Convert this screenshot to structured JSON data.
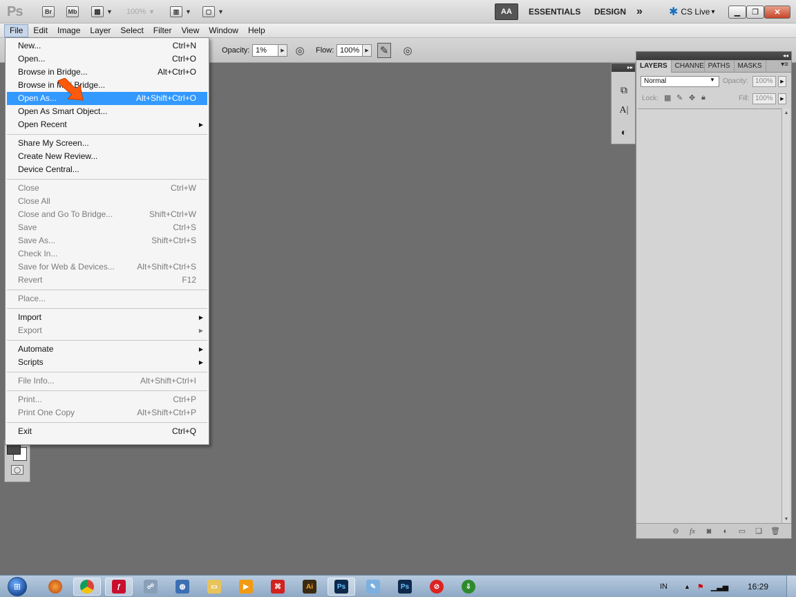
{
  "titlebar": {
    "app_logo": "Ps",
    "bridge": "Br",
    "mini_bridge": "Mb",
    "zoom": "100%",
    "workspace_current": "AA",
    "workspace_essentials": "ESSENTIALS",
    "workspace_design": "DESIGN",
    "more": "»",
    "cs_live": "CS Live",
    "cs_live_arrow": "▾"
  },
  "menubar": {
    "items": [
      "File",
      "Edit",
      "Image",
      "Layer",
      "Select",
      "Filter",
      "View",
      "Window",
      "Help"
    ]
  },
  "options": {
    "opacity_label": "Opacity:",
    "opacity_value": "1%",
    "flow_label": "Flow:",
    "flow_value": "100%"
  },
  "file_menu": {
    "items": [
      {
        "label": "New...",
        "shortcut": "Ctrl+N"
      },
      {
        "label": "Open...",
        "shortcut": "Ctrl+O"
      },
      {
        "label": "Browse in Bridge...",
        "shortcut": "Alt+Ctrl+O"
      },
      {
        "label": "Browse in Mini Bridge...",
        "shortcut": ""
      },
      {
        "label": "Open As...",
        "shortcut": "Alt+Shift+Ctrl+O"
      },
      {
        "label": "Open As Smart Object...",
        "shortcut": ""
      },
      {
        "label": "Open Recent",
        "shortcut": ""
      },
      {
        "label": "Share My Screen...",
        "shortcut": ""
      },
      {
        "label": "Create New Review...",
        "shortcut": ""
      },
      {
        "label": "Device Central...",
        "shortcut": ""
      },
      {
        "label": "Close",
        "shortcut": "Ctrl+W"
      },
      {
        "label": "Close All",
        "shortcut": ""
      },
      {
        "label": "Close and Go To Bridge...",
        "shortcut": "Shift+Ctrl+W"
      },
      {
        "label": "Save",
        "shortcut": "Ctrl+S"
      },
      {
        "label": "Save As...",
        "shortcut": "Shift+Ctrl+S"
      },
      {
        "label": "Check In...",
        "shortcut": ""
      },
      {
        "label": "Save for Web & Devices...",
        "shortcut": "Alt+Shift+Ctrl+S"
      },
      {
        "label": "Revert",
        "shortcut": "F12"
      },
      {
        "label": "Place...",
        "shortcut": ""
      },
      {
        "label": "Import",
        "shortcut": ""
      },
      {
        "label": "Export",
        "shortcut": ""
      },
      {
        "label": "Automate",
        "shortcut": ""
      },
      {
        "label": "Scripts",
        "shortcut": ""
      },
      {
        "label": "File Info...",
        "shortcut": "Alt+Shift+Ctrl+I"
      },
      {
        "label": "Print...",
        "shortcut": "Ctrl+P"
      },
      {
        "label": "Print One Copy",
        "shortcut": "Alt+Shift+Ctrl+P"
      },
      {
        "label": "Exit",
        "shortcut": "Ctrl+Q"
      }
    ],
    "submenu_arrow": "▶"
  },
  "layers_panel": {
    "tabs": [
      "LAYERS",
      "CHANNELS",
      "PATHS",
      "MASKS"
    ],
    "blend_mode": "Normal",
    "opacity_label": "Opacity:",
    "opacity_value": "100%",
    "lock_label": "Lock:",
    "fill_label": "Fill:",
    "fill_value": "100%",
    "collapse": "◂◂"
  },
  "minidock": {
    "collapse": "▸▸"
  },
  "taskbar": {
    "language": "IN",
    "clock": "16:29",
    "apps": [
      "Illustrator",
      "Photoshop"
    ],
    "ai_label": "Ai",
    "ps_label": "Ps"
  },
  "colors": {
    "highlight": "#3399ff",
    "canvas_bg": "#6e6e6e",
    "arrow": "#ff5a0a"
  }
}
